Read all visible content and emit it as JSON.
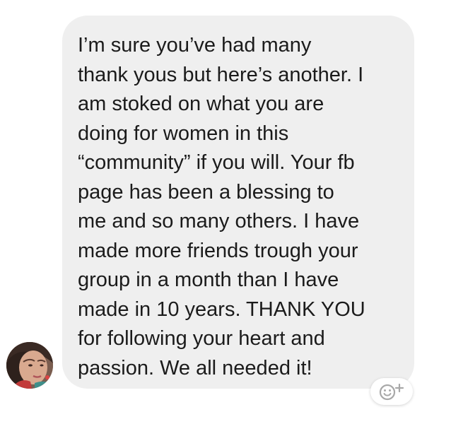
{
  "message": {
    "text": "I’m sure you’ve had many\nthank yous but here’s another. I\nam stoked on what you are\ndoing for women in this\n“community” if you will. Your fb\npage has been a blessing to\nme and so many others. I have\nmade more friends trough your\ngroup in a month than I have\nmade in 10 years. THANK YOU\nfor following your heart and\npassion. We all needed it!",
    "bubble_color": "#efefef",
    "text_color": "#1b1b1b"
  },
  "sender": {
    "avatar_icon": "profile-photo"
  },
  "reaction": {
    "icon": "add-reaction-smiley-plus-icon",
    "icon_color": "#a8a8a8"
  }
}
